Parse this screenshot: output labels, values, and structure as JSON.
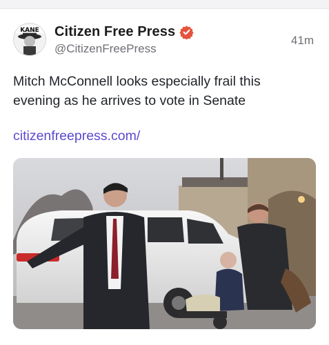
{
  "post": {
    "author": {
      "display_name": "Citizen Free Press",
      "handle": "@CitizenFreePress",
      "verified": true,
      "avatar_text": "KANE",
      "avatar_icon": "kane-avatar-logo"
    },
    "time": "41m",
    "text": "Mitch McConnell looks especially frail this evening as he arrives to vote in Senate",
    "link": "citizenfreepress.com/",
    "media": {
      "type": "photo",
      "description_icon": "news-photo"
    }
  },
  "colors": {
    "link": "#5b4ad0",
    "verified_badge": "#e5533d",
    "muted_text": "#6e6e75"
  }
}
